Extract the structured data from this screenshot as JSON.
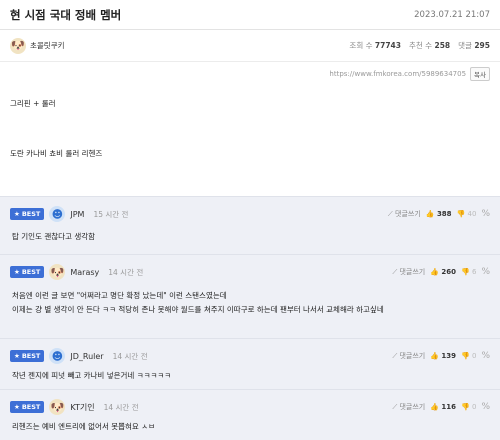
{
  "post": {
    "title": "현 시점 국대 정배 멤버",
    "date": "2023.07.21 21:07",
    "author": "초콜릿쿠키",
    "views_label": "조회 수",
    "views": "77743",
    "recs_label": "추천 수",
    "recs": "258",
    "comments_label": "댓글",
    "comments": "295",
    "url": "https://www.fmkorea.com/5989634705",
    "copy_label": "복사",
    "lines": [
      "그리핀 + 룰러",
      "도란 카나비 쵸비 룰러 리헨즈"
    ]
  },
  "comments": [
    {
      "badge": "BEST",
      "avatar": "blue-helmet-icon",
      "user": "JPM",
      "time": "15 시간 전",
      "reply": "댓글쓰기",
      "up": "388",
      "down": "40",
      "text": [
        "탑 기인도 괜찮다고 생각함"
      ]
    },
    {
      "badge": "BEST",
      "avatar": "dog-face-icon",
      "user": "Marasy",
      "time": "14 시간 전",
      "reply": "댓글쓰기",
      "up": "260",
      "down": "6",
      "text": [
        "처음엔 이런 글 보면 \"어쩌라고 명단 확정 났는데\" 이런 스탠스였는데",
        "이제는 걍 별 생각이 안 든다 ㅋㅋ 적당히 존나 못해야 월드를 쳐주지 이따구로 하는데 팬부터 나서서 교체해라 하고싶네"
      ]
    },
    {
      "badge": "BEST",
      "avatar": "blue-helmet-icon",
      "user": "JD_Ruler",
      "time": "14 시간 전",
      "reply": "댓글쓰기",
      "up": "139",
      "down": "0",
      "text": [
        "작년 젠지에 피넛 빼고 카나비 넣은거네 ㅋㅋㅋㅋㅋ"
      ]
    },
    {
      "badge": "BEST",
      "avatar": "dog-face-icon",
      "user": "KT기인",
      "time": "14 시간 전",
      "reply": "댓글쓰기",
      "up": "116",
      "down": "0",
      "text": [
        "리헨즈는 예비 엔트리에 없어서 못뽑혀요 ㅅㅂ"
      ]
    }
  ]
}
